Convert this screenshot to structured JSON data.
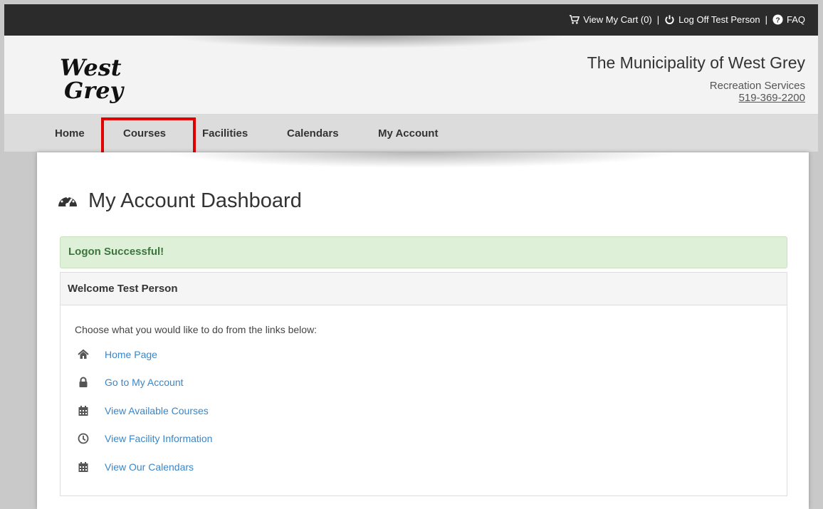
{
  "topbar": {
    "cart_label": "View My Cart (0)",
    "logoff_label": "Log Off Test Person",
    "faq_label": "FAQ",
    "separator": "|"
  },
  "header": {
    "logo_line1": "West",
    "logo_line2": "Grey",
    "org_name": "The Municipality of West Grey",
    "dept": "Recreation Services",
    "phone": "519-369-2200"
  },
  "nav": {
    "items": [
      "Home",
      "Courses",
      "Facilities",
      "Calendars",
      "My Account"
    ]
  },
  "main": {
    "title": "My Account Dashboard",
    "alert": "Logon Successful!",
    "panel_title": "Welcome Test Person",
    "intro": "Choose what you would like to do from the links below:",
    "links": [
      {
        "label": "Home Page",
        "icon": "home-icon"
      },
      {
        "label": "Go to My Account",
        "icon": "lock-icon"
      },
      {
        "label": "View Available Courses",
        "icon": "calendar-icon"
      },
      {
        "label": "View Facility Information",
        "icon": "clock-icon"
      },
      {
        "label": "View Our Calendars",
        "icon": "calendar-icon"
      }
    ]
  },
  "colors": {
    "topbar": "#2b2b2b",
    "link": "#3a86c8",
    "alert_bg": "#dff0d8",
    "alert_text": "#3c763d",
    "highlight": "#e00000"
  }
}
